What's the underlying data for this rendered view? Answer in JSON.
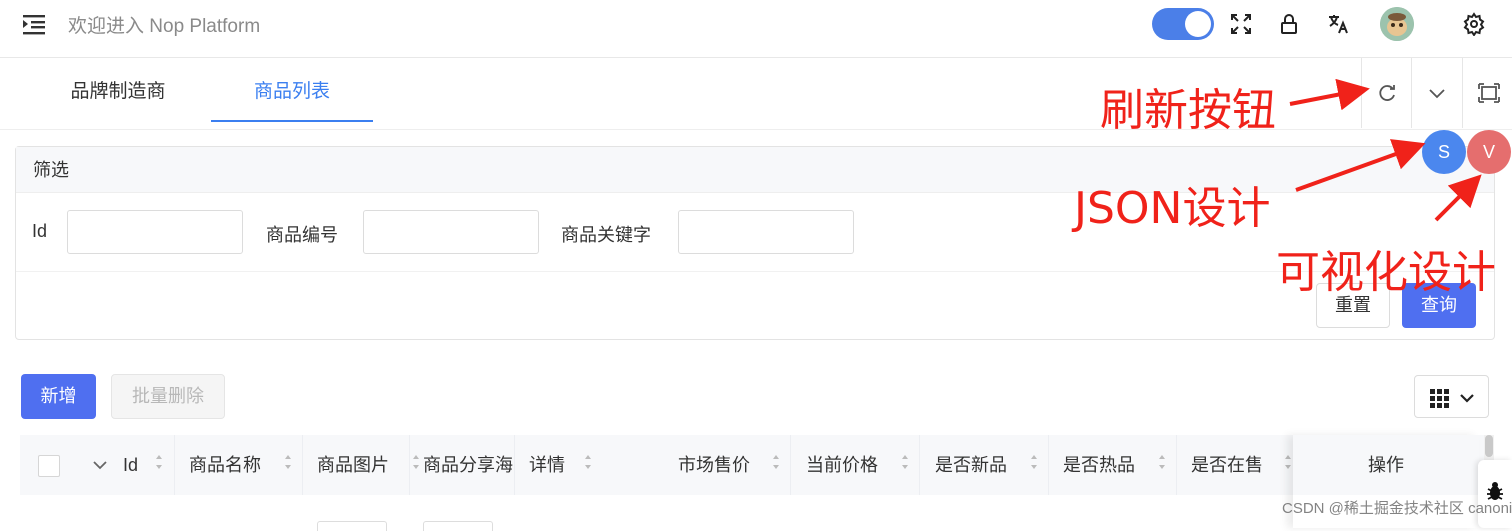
{
  "header": {
    "title": "欢迎进入 Nop Platform",
    "icons": [
      "menu-fold-icon",
      "theme-toggle",
      "fullscreen-icon",
      "lock-icon",
      "translate-icon",
      "avatar",
      "settings-icon"
    ]
  },
  "tabs": [
    {
      "label": "品牌制造商",
      "active": false
    },
    {
      "label": "商品列表",
      "active": true
    }
  ],
  "filter": {
    "title": "筛选",
    "fields": [
      {
        "label": "Id",
        "value": ""
      },
      {
        "label": "商品编号",
        "value": ""
      },
      {
        "label": "商品关键字",
        "value": ""
      }
    ],
    "reset_label": "重置",
    "query_label": "查询"
  },
  "toolbar": {
    "add_label": "新增",
    "bulk_delete_label": "批量删除"
  },
  "table": {
    "columns": [
      "Id",
      "商品名称",
      "商品图片",
      "商品分享海",
      "详情",
      "市场售价",
      "当前价格",
      "是否新品",
      "是否热品",
      "是否在售"
    ],
    "ops_label": "操作"
  },
  "floating": {
    "s_label": "S",
    "v_label": "V"
  },
  "annotations": {
    "refresh": "刷新按钮",
    "json": "JSON设计",
    "visual": "可视化设计"
  },
  "watermark": "CSDN @稀土掘金技术社区 canonical-entropy",
  "colors": {
    "primary": "#4f6ff0",
    "tab_active": "#3b7ff0",
    "annotation": "#f0221a",
    "fab_s": "#4b87ee",
    "fab_v": "#e56e6e"
  }
}
